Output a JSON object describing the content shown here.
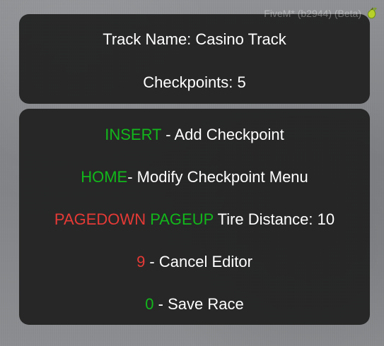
{
  "watermark": {
    "text": "FiveM* (b2944) (Beta)"
  },
  "info": {
    "track_name": "Track Name: Casino Track",
    "checkpoints": "Checkpoints: 5"
  },
  "controls": {
    "insert_key": "INSERT",
    "insert_text": " - Add Checkpoint",
    "home_key": "HOME",
    "home_text": "- Modify Checkpoint Menu",
    "pagedown_key": "PAGEDOWN",
    "pageup_key": "PAGEUP",
    "tire_distance_text": " Tire Distance: 10",
    "cancel_key": "9",
    "cancel_text": " - Cancel Editor",
    "save_key": "0",
    "save_text": " - Save Race"
  },
  "colors": {
    "green": "#12b81b",
    "red": "#e53a36",
    "white": "#ffffff",
    "panel": "#222222"
  },
  "icons": {
    "watermark_logo": "lime-pear-icon"
  }
}
